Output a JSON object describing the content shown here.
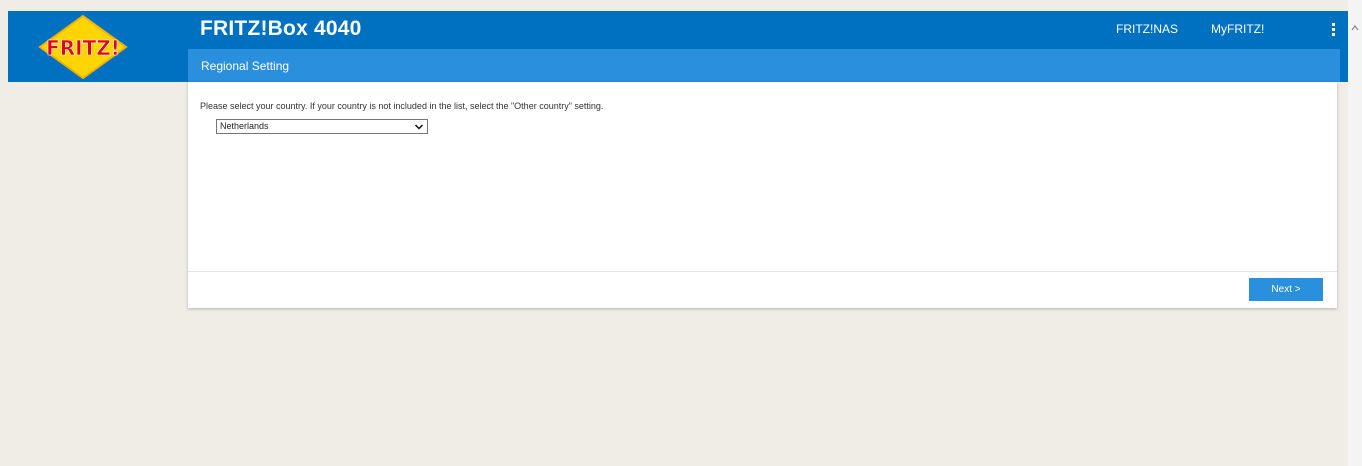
{
  "header": {
    "logo_text": "FRITZ!",
    "product_title": "FRITZ!Box 4040",
    "nav": [
      {
        "label": "FRITZ!NAS"
      },
      {
        "label": "MyFRITZ!"
      }
    ],
    "menu_icon": "kebab-menu-icon"
  },
  "page": {
    "subtitle": "Regional Setting",
    "prompt": "Please select your country. If your country is not included in the list, select the \"Other country\" setting.",
    "country_select": {
      "selected": "Netherlands"
    },
    "next_label": "Next >"
  },
  "colors": {
    "topbar": "#0070c0",
    "subbar": "#2a8fdc",
    "button": "#2a8fdc",
    "background": "#f0ede7",
    "logo_yellow": "#ffd500",
    "logo_red": "#e2001a"
  }
}
